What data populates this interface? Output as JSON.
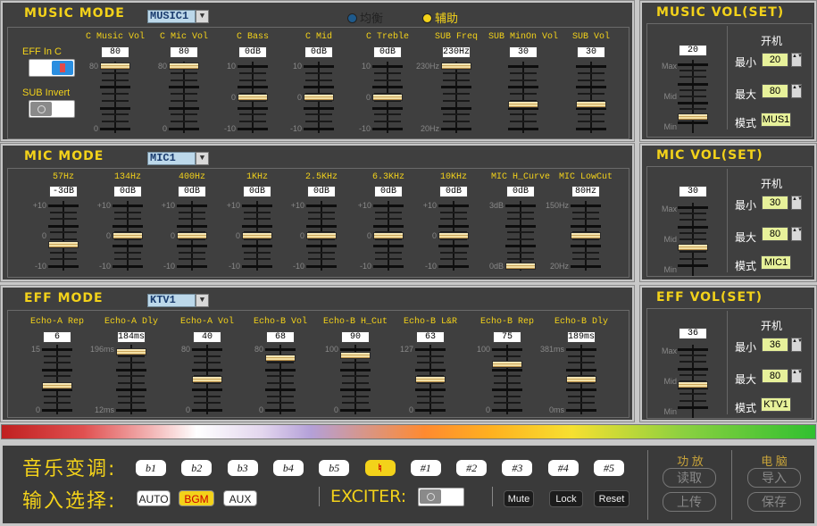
{
  "music": {
    "title": "MUSIC MODE",
    "mode": "MUSIC1",
    "radios": [
      {
        "label": "均衡",
        "selected": false
      },
      {
        "label": "辅助",
        "selected": true
      }
    ],
    "eff_in_c": "EFF In C",
    "sub_invert": "SUB Invert",
    "faders": [
      {
        "label": "C Music Vol",
        "value": "80",
        "scale": [
          "80",
          "",
          "0"
        ],
        "level": 0.0
      },
      {
        "label": "C Mic Vol",
        "value": "80",
        "scale": [
          "80",
          "",
          "0"
        ],
        "level": 0.0
      },
      {
        "label": "C Bass",
        "value": "0dB",
        "scale": [
          "10",
          "0",
          "-10"
        ],
        "level": 0.5
      },
      {
        "label": "C Mid",
        "value": "0dB",
        "scale": [
          "10",
          "0",
          "-10"
        ],
        "level": 0.5
      },
      {
        "label": "C Treble",
        "value": "0dB",
        "scale": [
          "10",
          "0",
          "-10"
        ],
        "level": 0.5
      },
      {
        "label": "SUB Freq",
        "value": "230Hz",
        "scale": [
          "230Hz",
          "",
          "20Hz"
        ],
        "level": 0.0
      },
      {
        "label": "SUB MinOn Vol",
        "value": "30",
        "scale": [
          "",
          "",
          ""
        ],
        "level": 0.62
      },
      {
        "label": "SUB Vol",
        "value": "30",
        "scale": [
          "",
          "",
          ""
        ],
        "level": 0.62
      }
    ]
  },
  "mic": {
    "title": "MIC MODE",
    "mode": "MIC1",
    "faders": [
      {
        "label": "57Hz",
        "value": "-3dB",
        "scale": [
          "+10",
          "0",
          "-10"
        ],
        "level": 0.65
      },
      {
        "label": "134Hz",
        "value": "0dB",
        "scale": [
          "+10",
          "0",
          "-10"
        ],
        "level": 0.5
      },
      {
        "label": "400Hz",
        "value": "0dB",
        "scale": [
          "+10",
          "0",
          "-10"
        ],
        "level": 0.5
      },
      {
        "label": "1KHz",
        "value": "0dB",
        "scale": [
          "+10",
          "0",
          "-10"
        ],
        "level": 0.5
      },
      {
        "label": "2.5KHz",
        "value": "0dB",
        "scale": [
          "+10",
          "0",
          "-10"
        ],
        "level": 0.5
      },
      {
        "label": "6.3KHz",
        "value": "0dB",
        "scale": [
          "+10",
          "0",
          "-10"
        ],
        "level": 0.5
      },
      {
        "label": "10KHz",
        "value": "0dB",
        "scale": [
          "+10",
          "0",
          "-10"
        ],
        "level": 0.5
      },
      {
        "label": "MIC H_Curve",
        "value": "0dB",
        "scale": [
          "3dB",
          "",
          "0dB"
        ],
        "level": 1.0
      },
      {
        "label": "MIC LowCut",
        "value": "80Hz",
        "scale": [
          "150Hz",
          "",
          "20Hz"
        ],
        "level": 0.5
      }
    ]
  },
  "eff": {
    "title": "EFF MODE",
    "mode": "KTV1",
    "faders": [
      {
        "label": "Echo-A Rep",
        "value": "6",
        "scale": [
          "15",
          "",
          "0"
        ],
        "level": 0.6
      },
      {
        "label": "Echo-A Dly",
        "value": "184ms",
        "scale": [
          "196ms",
          "",
          "12ms"
        ],
        "level": 0.05
      },
      {
        "label": "Echo-A Vol",
        "value": "40",
        "scale": [
          "80",
          "",
          "0"
        ],
        "level": 0.5
      },
      {
        "label": "Echo-B Vol",
        "value": "68",
        "scale": [
          "80",
          "",
          "0"
        ],
        "level": 0.15
      },
      {
        "label": "Echo-B H_Cut",
        "value": "90",
        "scale": [
          "100",
          "",
          "0"
        ],
        "level": 0.1
      },
      {
        "label": "Echo-B L&R",
        "value": "63",
        "scale": [
          "127",
          "",
          "0"
        ],
        "level": 0.5
      },
      {
        "label": "Echo-B Rep",
        "value": "75",
        "scale": [
          "100",
          "",
          "0"
        ],
        "level": 0.25
      },
      {
        "label": "Echo-B Dly",
        "value": "189ms",
        "scale": [
          "381ms",
          "",
          "0ms"
        ],
        "level": 0.5
      }
    ]
  },
  "vol_panels": [
    {
      "title": "MUSIC VOL(SET)",
      "value": "20",
      "level": 0.82,
      "scale": [
        "Max",
        "Mid",
        "Min"
      ],
      "on_label": "开机",
      "min_label": "最小",
      "min": "20",
      "max_label": "最大",
      "max": "80",
      "mode_label": "模式",
      "mode": "MUS1"
    },
    {
      "title": "MIC VOL(SET)",
      "value": "30",
      "level": 0.62,
      "scale": [
        "Max",
        "Mid",
        "Min"
      ],
      "on_label": "开机",
      "min_label": "最小",
      "min": "30",
      "max_label": "最大",
      "max": "80",
      "mode_label": "模式",
      "mode": "MIC1"
    },
    {
      "title": "EFF VOL(SET)",
      "value": "36",
      "level": 0.55,
      "scale": [
        "Max",
        "Mid",
        "Min"
      ],
      "on_label": "开机",
      "min_label": "最小",
      "min": "36",
      "max_label": "最大",
      "max": "80",
      "mode_label": "模式",
      "mode": "KTV1"
    }
  ],
  "bottom": {
    "key_label": "音乐变调:",
    "keys": [
      "b1",
      "b2",
      "b3",
      "b4",
      "b5",
      "♮",
      "#1",
      "#2",
      "#3",
      "#4",
      "#5"
    ],
    "selected_key": 5,
    "input_label": "输入选择:",
    "inputs": [
      "AUTO",
      "BGM",
      "AUX"
    ],
    "selected_input": 1,
    "exciter_label": "EXCITER:",
    "mute": "Mute",
    "lock": "Lock",
    "reset": "Reset",
    "amp_group": "功 放",
    "read": "读取",
    "upload": "上传",
    "pc_group": "电 脑",
    "import": "导入",
    "save": "保存"
  },
  "colors": {
    "accent": "#f3d21a",
    "panel": "#3f3f3f",
    "selected": "#f3d21a"
  }
}
